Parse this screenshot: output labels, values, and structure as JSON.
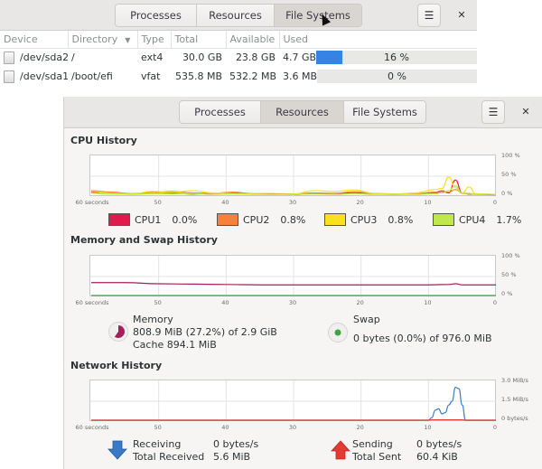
{
  "back_window": {
    "tabs": [
      {
        "label": "Processes",
        "active": false
      },
      {
        "label": "Resources",
        "active": false
      },
      {
        "label": "File Systems",
        "active": true
      }
    ],
    "menu_icon": "hamburger-menu-icon",
    "close_icon": "close-icon",
    "table": {
      "columns": [
        "Device",
        "Directory",
        "Type",
        "Total",
        "Available",
        "Used"
      ],
      "sorted_column": "Directory",
      "rows": [
        {
          "device": "/dev/sda2",
          "directory": "/",
          "type": "ext4",
          "total": "30.0 GB",
          "available": "23.8 GB",
          "used": "4.7 GB",
          "used_percent": 16,
          "used_percent_label": "16 %"
        },
        {
          "device": "/dev/sda1",
          "directory": "/boot/efi",
          "type": "vfat",
          "total": "535.8 MB",
          "available": "532.2 MB",
          "used": "3.6 MB",
          "used_percent": 0,
          "used_percent_label": "0 %"
        }
      ]
    }
  },
  "front_window": {
    "tabs": [
      {
        "label": "Processes",
        "active": false
      },
      {
        "label": "Resources",
        "active": true
      },
      {
        "label": "File Systems",
        "active": false
      }
    ],
    "menu_icon": "hamburger-menu-icon",
    "close_icon": "close-icon",
    "cpu": {
      "title": "CPU History",
      "legend": [
        {
          "name": "CPU1",
          "value": "0.0%",
          "color": "#e01b4c"
        },
        {
          "name": "CPU2",
          "value": "0.8%",
          "color": "#f5813a"
        },
        {
          "name": "CPU3",
          "value": "0.8%",
          "color": "#f9e11e"
        },
        {
          "name": "CPU4",
          "value": "1.7%",
          "color": "#bfe94a"
        }
      ]
    },
    "memory": {
      "title": "Memory and Swap History",
      "memory_label": "Memory",
      "memory_usage": "808.9 MiB (27.2%) of 2.9 GiB",
      "memory_cache": "Cache 894.1 MiB",
      "memory_color": "#a51d5c",
      "swap_label": "Swap",
      "swap_usage": "0 bytes (0.0%) of 976.0 MiB",
      "swap_color": "#3fa33f"
    },
    "network": {
      "title": "Network History",
      "receiving_label": "Receiving",
      "receiving_value": "0 bytes/s",
      "total_received_label": "Total Received",
      "total_received_value": "5.6 MiB",
      "sending_label": "Sending",
      "sending_value": "0 bytes/s",
      "total_sent_label": "Total Sent",
      "total_sent_value": "60.4 KiB",
      "receiving_color": "#3a79c6",
      "sending_color": "#e53a33"
    }
  },
  "chart_data": [
    {
      "type": "line",
      "title": "CPU History",
      "xlabel": "",
      "ylabel": "",
      "x_ticks": [
        "60 seconds",
        "50",
        "40",
        "30",
        "20",
        "10",
        "0"
      ],
      "y_ticks": [
        "100 %",
        "50 %",
        "0 %"
      ],
      "xlim": [
        60,
        0
      ],
      "ylim": [
        0,
        100
      ],
      "x": [
        60,
        57,
        54,
        51,
        48,
        45,
        42,
        39,
        36,
        33,
        30,
        27,
        24,
        21,
        18,
        15,
        12,
        9,
        8,
        7,
        6,
        5,
        4,
        3,
        2,
        0
      ],
      "series": [
        {
          "name": "CPU1",
          "color": "#e01b4c",
          "values": [
            8,
            6,
            3,
            4,
            5,
            3,
            4,
            5,
            3,
            3,
            2,
            4,
            3,
            7,
            3,
            2,
            3,
            6,
            10,
            6,
            40,
            5,
            3,
            2,
            2,
            1
          ]
        },
        {
          "name": "CPU2",
          "color": "#f5813a",
          "values": [
            12,
            8,
            4,
            8,
            10,
            6,
            5,
            8,
            4,
            4,
            3,
            6,
            5,
            9,
            4,
            3,
            4,
            8,
            12,
            8,
            15,
            6,
            4,
            3,
            3,
            2
          ]
        },
        {
          "name": "CPU3",
          "color": "#f9e11e",
          "values": [
            10,
            5,
            3,
            10,
            8,
            12,
            6,
            4,
            3,
            2,
            3,
            12,
            10,
            14,
            5,
            3,
            6,
            15,
            18,
            48,
            20,
            5,
            22,
            4,
            3,
            2
          ]
        },
        {
          "name": "CPU4",
          "color": "#bfe94a",
          "values": [
            5,
            3,
            2,
            4,
            3,
            4,
            2,
            3,
            2,
            2,
            2,
            3,
            2,
            4,
            2,
            2,
            2,
            4,
            6,
            12,
            25,
            4,
            5,
            2,
            2,
            2
          ]
        }
      ],
      "grid": true
    },
    {
      "type": "line",
      "title": "Memory and Swap History",
      "x_ticks": [
        "60 seconds",
        "50",
        "40",
        "30",
        "20",
        "10",
        "0"
      ],
      "y_ticks": [
        "100 %",
        "50 %",
        "0 %"
      ],
      "xlim": [
        60,
        0
      ],
      "ylim": [
        0,
        100
      ],
      "x": [
        60,
        55,
        50,
        45,
        40,
        35,
        30,
        25,
        20,
        15,
        10,
        7,
        6,
        5,
        0
      ],
      "series": [
        {
          "name": "Memory",
          "color": "#a51d5c",
          "values": [
            34,
            34,
            31,
            30,
            29,
            28,
            28,
            28,
            28,
            28,
            28,
            29,
            31,
            28,
            28
          ]
        },
        {
          "name": "Swap",
          "color": "#3fa33f",
          "values": [
            0,
            0,
            0,
            0,
            0,
            0,
            0,
            0,
            0,
            0,
            0,
            0,
            0,
            0,
            0
          ]
        }
      ],
      "grid": true
    },
    {
      "type": "line",
      "title": "Network History",
      "x_ticks": [
        "60 seconds",
        "50",
        "40",
        "30",
        "20",
        "10",
        "0"
      ],
      "y_ticks": [
        "3.0 MiB/s",
        "1.5 MiB/s",
        "0 bytes/s"
      ],
      "xlim": [
        60,
        0
      ],
      "ylim": [
        0,
        3.0
      ],
      "x": [
        60,
        50,
        40,
        30,
        20,
        10,
        9.5,
        9,
        8.5,
        8,
        7.5,
        7,
        6.5,
        6,
        5.5,
        5,
        4.5,
        4,
        0
      ],
      "series": [
        {
          "name": "Receiving",
          "color": "#3a79c6",
          "values": [
            0,
            0,
            0,
            0,
            0,
            0,
            0.2,
            0.8,
            0.9,
            0.5,
            0.6,
            1.2,
            1.5,
            2.6,
            2.5,
            1.2,
            0,
            0,
            0
          ]
        },
        {
          "name": "Sending",
          "color": "#e53a33",
          "values": [
            0,
            0,
            0,
            0,
            0,
            0,
            0.03,
            0.03,
            0.03,
            0.03,
            0.03,
            0.03,
            0.03,
            0.03,
            0.03,
            0.03,
            0,
            0,
            0
          ]
        }
      ],
      "grid": true
    }
  ]
}
